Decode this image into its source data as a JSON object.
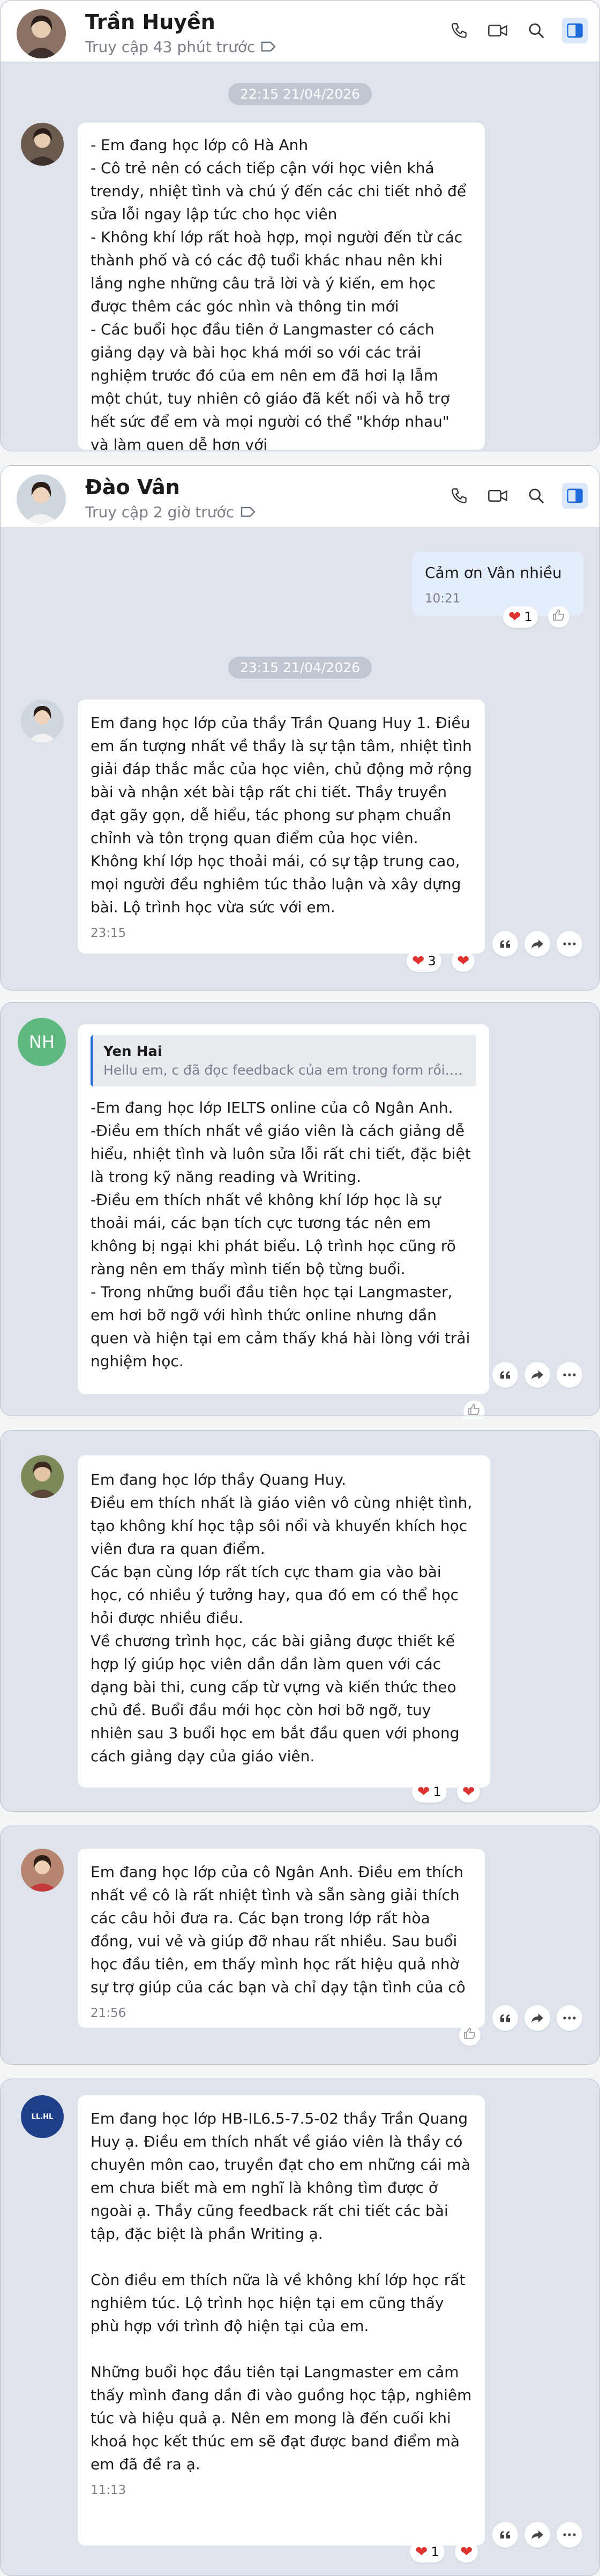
{
  "colors": {
    "accent": "#1f6bdc",
    "heart": "#e0322f",
    "panel_bg": "#dfe4ec",
    "nh_avatar": "#5eb87f"
  },
  "cards": [
    {
      "header": {
        "name": "Trần Huyền",
        "status": "Truy cập 43 phút trước"
      },
      "timestamp": "22:15 21/04/2026",
      "message": "- Em đang học lớp cô Hà Anh\n- Cô trẻ nên có cách tiếp cận với học viên khá trendy, nhiệt tình và chú ý đến các chi tiết nhỏ để sửa lỗi ngay lập tức cho học viên\n- Không khí lớp rất hoà hợp, mọi người đến từ các thành phố và có các độ tuổi khác nhau nên khi lắng nghe những câu trả lời và ý kiến, em học được thêm các góc nhìn và thông tin mới\n- Các buổi học đầu tiên ở Langmaster có cách giảng dạy và bài học khá mới so với các trải nghiệm trước đó của em nên em đã hơi lạ lẫm một chút, tuy nhiên cô giáo đã kết nối và hỗ trợ hết sức để em và mọi người có thể \"khớp nhau\" và làm quen dễ hơn với"
    },
    {
      "header": {
        "name": "Đào Vân",
        "status": "Truy cập 2 giờ trước"
      },
      "outgoing": {
        "text": "Cảm ơn Vân nhiều",
        "time": "10:21",
        "reaction_count": "1"
      },
      "timestamp": "23:15 21/04/2026",
      "message": "Em đang học lớp của thầy Trần Quang Huy 1. Điều em ấn tượng nhất về thầy là sự tận tâm, nhiệt tình giải đáp thắc mắc của học viên, chủ động mở rộng bài và nhận xét bài tập rất chi tiết. Thầy truyền đạt gãy gọn, dễ hiểu, tác phong sư phạm chuẩn chỉnh và tôn trọng quan điểm của học viên.\nKhông khí lớp học thoải mái, có sự tập trung cao, mọi người đều nghiêm túc thảo luận và xây dựng bài. Lộ trình học vừa sức với em.",
      "time": "23:15",
      "reaction_count": "3"
    },
    {
      "avatar_initials": "NH",
      "quote": {
        "name": "Yen Hai",
        "text": "Hellu em, c đã đọc feedback của em trong form rồi. Cả..."
      },
      "message": "-Em đang học lớp IELTS online của cô Ngân Anh.\n-Điều em thích nhất về giáo viên là cách giảng dễ hiểu, nhiệt tình và luôn sửa lỗi rất chi tiết, đặc biệt là trong kỹ năng reading và Writing.\n-Điều em thích nhất về không khí lớp học là sự thoải mái, các bạn tích cực tương tác nên em không bị ngại khi phát biểu. Lộ trình học cũng rõ ràng nên em thấy mình tiến bộ từng buổi.\n- Trong những buổi đầu tiên học tại Langmaster, em hơi bỡ ngỡ với hình thức online nhưng dần quen và hiện tại em cảm thấy khá hài lòng với trải nghiệm học."
    },
    {
      "message": "Em đang học lớp thầy Quang Huy.\nĐiều em thích nhất là giáo viên vô cùng nhiệt tình, tạo không khí học tập sôi nổi và khuyến khích học viên đưa ra quan điểm.\nCác bạn cùng lớp rất tích cực tham gia vào bài học, có nhiều ý tưởng hay, qua đó em có thể học hỏi được nhiều điều.\nVề chương trình học, các bài giảng được thiết kế hợp lý giúp học viên dần dần làm quen với các dạng bài thi, cung cấp từ vựng và kiến thức theo chủ đề. Buổi đầu mới học còn hơi bỡ ngỡ, tuy nhiên sau 3 buổi học em bắt đầu quen với phong cách giảng dạy của giáo viên.",
      "reaction_count": "1"
    },
    {
      "message": "Em đang học lớp của cô Ngân Anh. Điều em thích nhất về cô là rất nhiệt tình và sẵn sàng giải thích các câu hỏi đưa ra. Các bạn trong lớp rất hòa đồng, vui vẻ và giúp đỡ nhau rất nhiều. Sau buổi học đầu tiên, em thấy mình học rất hiệu quả nhờ sự trợ giúp của các bạn và chỉ dạy tận tình của cô",
      "time": "21:56"
    },
    {
      "avatar_label": "LL.HL",
      "message": "Em đang học lớp HB-IL6.5-7.5-02 thầy Trần Quang Huy ạ. Điều em thích nhất về giáo viên là thầy có chuyên môn cao, truyền đạt cho em những cái mà em chưa biết mà em nghĩ là không tìm được ở ngoài ạ. Thầy cũng feedback rất chi tiết các bài tập, đặc biệt là phần Writing ạ.\n\nCòn điều em thích nữa là về không khí lớp học rất nghiêm túc. Lộ trình học hiện tại em cũng thấy phù hợp với trình độ hiện tại của em.\n\nNhững buổi học đầu tiên tại Langmaster em cảm thấy mình đang dần đi vào guồng học tập, nghiêm túc và hiệu quả ạ. Nên em mong là đến cuối khi khoá học kết thúc em sẽ đạt được band điểm mà em đã đề ra ạ.",
      "time": "11:13",
      "reaction_count": "1"
    }
  ]
}
